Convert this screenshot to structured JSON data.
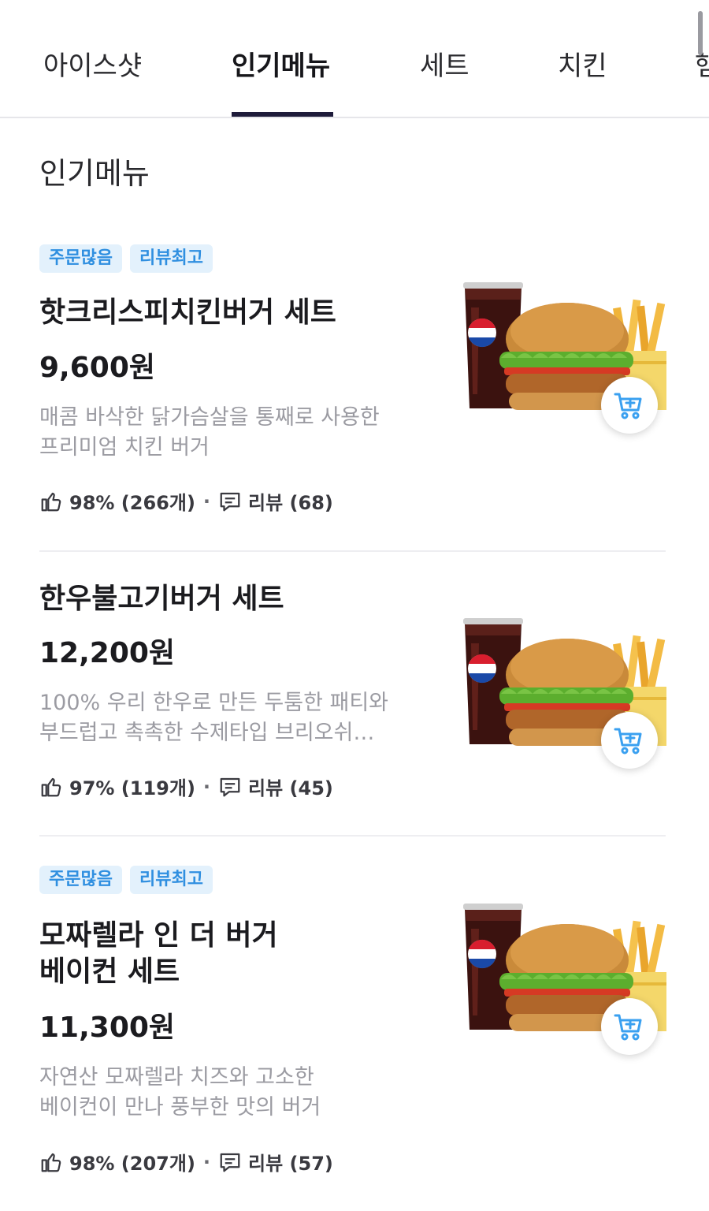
{
  "tabs": [
    {
      "label": "아이스샷"
    },
    {
      "label": "인기메뉴"
    },
    {
      "label": "세트"
    },
    {
      "label": "치킨"
    },
    {
      "label": "햄"
    }
  ],
  "section_title": "인기메뉴",
  "items": [
    {
      "badges": [
        "주문많음",
        "리뷰최고"
      ],
      "name": "핫크리스피치킨버거 세트",
      "price": "9,600원",
      "desc_line1": "매콤 바삭한 닭가슴살을 통째로 사용한",
      "desc_line2": "프리미엄 치킨 버거",
      "rating": "98% (266개)",
      "reviews": "리뷰 (68)"
    },
    {
      "badges": [],
      "name": "한우불고기버거 세트",
      "price": "12,200원",
      "desc_line1": "100% 우리 한우로 만든 두툼한 패티와",
      "desc_line2": "부드럽고 촉촉한 수제타입 브리오쉬…",
      "rating": "97% (119개)",
      "reviews": "리뷰 (45)"
    },
    {
      "badges": [
        "주문많음",
        "리뷰최고"
      ],
      "name_line1": "모짜렐라 인 더 버거",
      "name_line2": "베이컨 세트",
      "price": "11,300원",
      "desc_line1": "자연산 모짜렐라 치즈와 고소한",
      "desc_line2": "베이컨이 만나 풍부한 맛의 버거",
      "rating": "98% (207개)",
      "reviews": "리뷰 (57)"
    }
  ],
  "cup_logo": "PEPSI",
  "patty_brand": "한우",
  "colors": {
    "badge_bg": "#e3f1fc",
    "badge_text": "#2f8fe0",
    "tab_indicator": "#1e1b3a",
    "cart_icon": "#3aa0f0"
  }
}
